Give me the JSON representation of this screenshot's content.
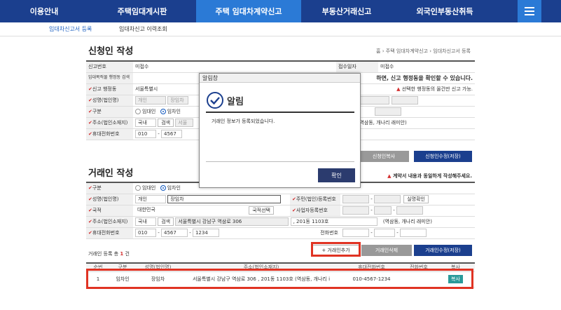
{
  "nav": {
    "items": [
      "이용안내",
      "주택임대게시판",
      "주택 임대차계약신고",
      "부동산거래신고",
      "외국인부동산취득"
    ],
    "active_index": 2
  },
  "subnav": {
    "items": [
      "임대차신고서 등록",
      "임대차신고 이력조회"
    ]
  },
  "applicant": {
    "title": "신청인 작성",
    "breadcrumb": {
      "home": "홈",
      "sep": "›",
      "level1": "주택 임대차계약신고",
      "level2": "임대차신고서 등록"
    },
    "receipt_no_label": "신고번호",
    "receipt_no_value": "미접수",
    "receipt_date_label": "접수일자",
    "receipt_date_value": "미접수",
    "district_search_label": "임대목적물 행정동 검색",
    "district_search_note": "하면, 신고 행정동을 확인할 수 있습니다.",
    "office_label": "신고 행정동",
    "office_value": "서울특별시",
    "office_warning": "선택한 행정동의 올건만 신고 가능.",
    "name_label": "성명(법인명)",
    "name_type": "개인",
    "name_value": "장임차",
    "type_label": "구분",
    "type_opt1": "임대인",
    "type_opt2": "임차인",
    "addr_label": "주소(법인소재지)",
    "addr_country": "국내",
    "addr_search": "검색",
    "addr_value": "서울",
    "addr_extra": "(역삼동, 개나리 래미안)",
    "phone_label": "휴대전화번호",
    "phone1": "010",
    "phone2": "4567",
    "copy_button": "신청인복사",
    "save_button": "신청인수정(저장)"
  },
  "popup": {
    "window_title": "알림창",
    "heading": "알림",
    "message": "거래인 정보가 등록되었습니다.",
    "ok": "확인"
  },
  "party": {
    "title": "거래인 작성",
    "warning": "계약서 내용과 동일하게 작성해주세요.",
    "type_label": "구분",
    "type_opt1": "임대인",
    "type_opt2": "임차인",
    "name_label": "성명(법인명)",
    "name_type": "개인",
    "name_value": "장임차",
    "id_label": "주민(법인)등록번호",
    "verify_button": "실명확인",
    "nation_label": "국적",
    "nation_value": "대한민국",
    "nation_button": "국적선택",
    "biz_label": "사업자등록번호",
    "addr_label": "주소(법인소재지)",
    "addr_country": "국내",
    "addr_search": "검색",
    "addr_value": "서울특별시 강남구 역삼로 306",
    "addr_detail": ", 201동 1103호",
    "addr_extra": "(역삼동, 개나리 래미안)",
    "phone_label": "휴대전화번호",
    "phone1": "010",
    "phone2": "4567",
    "phone3": "1234",
    "tel_label": "전화번호",
    "add_button": "+ 거래인추가",
    "delete_button": "거래인삭제",
    "edit_button": "거래인수정(저장)"
  },
  "list": {
    "count_label": "거래인 등록 총",
    "count": "1",
    "count_unit": "건",
    "headers": [
      "순번",
      "구분",
      "성명(법인명)",
      "주소(법인소재지)",
      "휴대전화번호",
      "전화번호",
      "복사"
    ],
    "row": {
      "no": "1",
      "type": "임차인",
      "name": "장임차",
      "addr": "서울특별시 강남구 역삼로 306 , 201동 1103호  (역삼동, 개나리 i",
      "mobile": "010-4567-1234",
      "tel": "",
      "copy": "복사"
    }
  },
  "colors": {
    "nav": "#1b3f8e",
    "nav_active": "#2b7ad6",
    "highlight": "#e03323"
  }
}
